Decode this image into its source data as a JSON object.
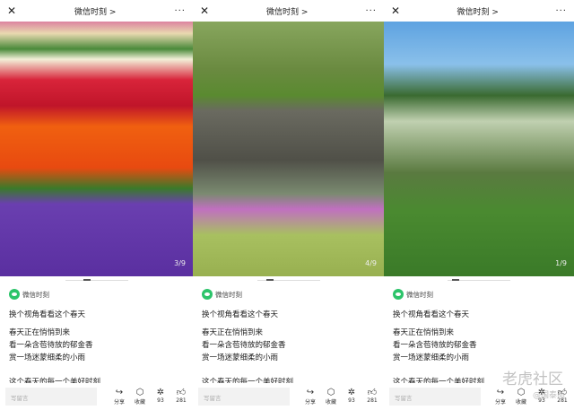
{
  "panels": [
    {
      "title": "微信时刻 >",
      "counter": "3/9",
      "source": "微信时刻",
      "heading": "换个视角看看这个春天",
      "lines": [
        "春天正在悄悄到来",
        "看一朵含苞待放的郁金香",
        "赏一场迷蒙细柔的小雨"
      ],
      "closing": "这个春天的每一个美好时刻",
      "comment_placeholder": "写留言",
      "actions": {
        "share": "分享",
        "collect": "收藏",
        "wow": "93",
        "like": "281"
      }
    },
    {
      "title": "微信时刻 >",
      "counter": "4/9",
      "source": "微信时刻",
      "heading": "换个视角看看这个春天",
      "lines": [
        "春天正在悄悄到来",
        "看一朵含苞待放的郁金香",
        "赏一场迷蒙细柔的小雨"
      ],
      "closing": "这个春天的每一个美好时刻",
      "comment_placeholder": "写留言",
      "actions": {
        "share": "分享",
        "collect": "收藏",
        "wow": "93",
        "like": "281"
      }
    },
    {
      "title": "微信时刻 >",
      "counter": "1/9",
      "source": "微信时刻",
      "heading": "换个视角看看这个春天",
      "lines": [
        "春天正在悄悄到来",
        "看一朵含苞待放的郁金香",
        "赏一场迷蒙细柔的小雨"
      ],
      "closing": "这个春天的每一个美好时刻",
      "comment_placeholder": "写留言",
      "actions": {
        "share": "分享",
        "collect": "收藏",
        "wow": "93",
        "like": "281"
      }
    }
  ],
  "watermark": {
    "brand": "老虎社区",
    "user": "@国泰雨"
  },
  "icons": [
    "close-icon",
    "more-icon",
    "share-icon",
    "collect-icon",
    "wow-icon",
    "like-icon"
  ]
}
